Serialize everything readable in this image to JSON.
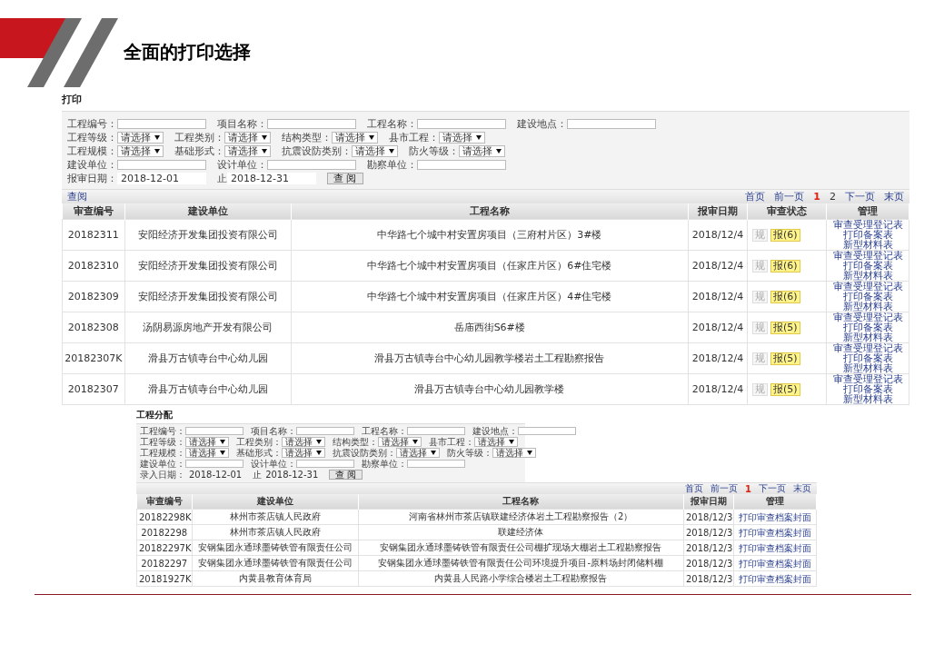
{
  "header": {
    "title": "全面的打印选择"
  },
  "panels": [
    {
      "title": "打印",
      "filters": [
        [
          {
            "kind": "input",
            "label": "工程编号："
          },
          {
            "kind": "input",
            "label": "项目名称："
          },
          {
            "kind": "input",
            "label": "工程名称："
          },
          {
            "kind": "input",
            "label": "建设地点："
          }
        ],
        [
          {
            "kind": "select",
            "label": "工程等级：",
            "value": "请选择"
          },
          {
            "kind": "select",
            "label": "工程类别：",
            "value": "请选择"
          },
          {
            "kind": "select",
            "label": "结构类型：",
            "value": "请选择"
          },
          {
            "kind": "select",
            "label": "县市工程：",
            "value": "请选择"
          }
        ],
        [
          {
            "kind": "select",
            "label": "工程规模：",
            "value": "请选择"
          },
          {
            "kind": "select",
            "label": "基础形式：",
            "value": "请选择"
          },
          {
            "kind": "select",
            "label": "抗震设防类别：",
            "value": "请选择"
          },
          {
            "kind": "select",
            "label": "防火等级：",
            "value": "请选择"
          }
        ],
        [
          {
            "kind": "input",
            "label": "建设单位："
          },
          {
            "kind": "input",
            "label": "设计单位："
          },
          {
            "kind": "input",
            "label": "勘察单位："
          }
        ],
        [
          {
            "kind": "date",
            "label": "报审日期：",
            "value": "2018-12-01"
          },
          {
            "kind": "date",
            "label": "止",
            "value": "2018-12-31"
          },
          {
            "kind": "button",
            "label": "查 阅"
          }
        ]
      ],
      "query_link": "查阅",
      "pager": [
        {
          "kind": "link",
          "label": "首页"
        },
        {
          "kind": "link",
          "label": "前一页"
        },
        {
          "kind": "page",
          "label": "1",
          "selected": true
        },
        {
          "kind": "page",
          "label": "2",
          "selected": false
        },
        {
          "kind": "link",
          "label": "下一页"
        },
        {
          "kind": "link",
          "label": "末页"
        }
      ],
      "columns": [
        {
          "kind": "id",
          "label": "审查编号"
        },
        {
          "kind": "unit",
          "label": "建设单位"
        },
        {
          "kind": "name",
          "label": "工程名称"
        },
        {
          "kind": "date",
          "label": "报审日期"
        },
        {
          "kind": "status",
          "label": "审查状态"
        },
        {
          "kind": "manage",
          "label": "管理"
        }
      ],
      "rows": [
        {
          "cells": [
            {
              "kind": "text",
              "text": "20182311"
            },
            {
              "kind": "text",
              "text": "安阳经济开发集团投资有限公司"
            },
            {
              "kind": "text",
              "text": "中华路七个城中村安置房项目（三府村片区）3#楼"
            },
            {
              "kind": "text",
              "text": "2018/12/4"
            },
            {
              "kind": "status",
              "items": [
                {
                  "label": "规",
                  "highlighted": false
                },
                {
                  "label": "报(6)",
                  "highlighted": true
                }
              ]
            },
            {
              "kind": "links",
              "items": [
                "审查受理登记表",
                "打印备案表",
                "新型材料表"
              ]
            }
          ]
        },
        {
          "cells": [
            {
              "kind": "text",
              "text": "20182310"
            },
            {
              "kind": "text",
              "text": "安阳经济开发集团投资有限公司"
            },
            {
              "kind": "text",
              "text": "中华路七个城中村安置房项目（任家庄片区）6#住宅楼"
            },
            {
              "kind": "text",
              "text": "2018/12/4"
            },
            {
              "kind": "status",
              "items": [
                {
                  "label": "规",
                  "highlighted": false
                },
                {
                  "label": "报(6)",
                  "highlighted": true
                }
              ]
            },
            {
              "kind": "links",
              "items": [
                "审查受理登记表",
                "打印备案表",
                "新型材料表"
              ]
            }
          ]
        },
        {
          "cells": [
            {
              "kind": "text",
              "text": "20182309"
            },
            {
              "kind": "text",
              "text": "安阳经济开发集团投资有限公司"
            },
            {
              "kind": "text",
              "text": "中华路七个城中村安置房项目（任家庄片区）4#住宅楼"
            },
            {
              "kind": "text",
              "text": "2018/12/4"
            },
            {
              "kind": "status",
              "items": [
                {
                  "label": "规",
                  "highlighted": false
                },
                {
                  "label": "报(6)",
                  "highlighted": true
                }
              ]
            },
            {
              "kind": "links",
              "items": [
                "审查受理登记表",
                "打印备案表",
                "新型材料表"
              ]
            }
          ]
        },
        {
          "cells": [
            {
              "kind": "text",
              "text": "20182308"
            },
            {
              "kind": "text",
              "text": "汤阴易源房地产开发有限公司"
            },
            {
              "kind": "text",
              "text": "岳庙西街S6#楼"
            },
            {
              "kind": "text",
              "text": "2018/12/4"
            },
            {
              "kind": "status",
              "items": [
                {
                  "label": "规",
                  "highlighted": false
                },
                {
                  "label": "报(5)",
                  "highlighted": true
                }
              ]
            },
            {
              "kind": "links",
              "items": [
                "审查受理登记表",
                "打印备案表",
                "新型材料表"
              ]
            }
          ]
        },
        {
          "cells": [
            {
              "kind": "text",
              "text": "20182307K"
            },
            {
              "kind": "text",
              "text": "滑县万古镇寺台中心幼儿园"
            },
            {
              "kind": "text",
              "text": "滑县万古镇寺台中心幼儿园教学楼岩土工程勘察报告"
            },
            {
              "kind": "text",
              "text": "2018/12/4"
            },
            {
              "kind": "status",
              "items": [
                {
                  "label": "规",
                  "highlighted": false
                },
                {
                  "label": "报(5)",
                  "highlighted": true
                }
              ]
            },
            {
              "kind": "links",
              "items": [
                "审查受理登记表",
                "打印备案表",
                "新型材料表"
              ]
            }
          ]
        },
        {
          "cells": [
            {
              "kind": "text",
              "text": "20182307"
            },
            {
              "kind": "text",
              "text": "滑县万古镇寺台中心幼儿园"
            },
            {
              "kind": "text",
              "text": "滑县万古镇寺台中心幼儿园教学楼"
            },
            {
              "kind": "text",
              "text": "2018/12/4"
            },
            {
              "kind": "status",
              "items": [
                {
                  "label": "规",
                  "highlighted": false
                },
                {
                  "label": "报(5)",
                  "highlighted": true
                }
              ]
            },
            {
              "kind": "links",
              "items": [
                "审查受理登记表",
                "打印备案表",
                "新型材料表"
              ]
            }
          ]
        }
      ]
    },
    {
      "title": "工程分配",
      "filters": [
        [
          {
            "kind": "input",
            "label": "工程编号："
          },
          {
            "kind": "input",
            "label": "项目名称："
          },
          {
            "kind": "input",
            "label": "工程名称："
          },
          {
            "kind": "input",
            "label": "建设地点："
          }
        ],
        [
          {
            "kind": "select",
            "label": "工程等级：",
            "value": "请选择"
          },
          {
            "kind": "select",
            "label": "工程类别：",
            "value": "请选择"
          },
          {
            "kind": "select",
            "label": "结构类型：",
            "value": "请选择"
          },
          {
            "kind": "select",
            "label": "县市工程：",
            "value": "请选择"
          }
        ],
        [
          {
            "kind": "select",
            "label": "工程规模：",
            "value": "请选择"
          },
          {
            "kind": "select",
            "label": "基础形式：",
            "value": "请选择"
          },
          {
            "kind": "select",
            "label": "抗震设防类别：",
            "value": "请选择"
          },
          {
            "kind": "select",
            "label": "防火等级：",
            "value": "请选择"
          }
        ],
        [
          {
            "kind": "input",
            "label": "建设单位："
          },
          {
            "kind": "input",
            "label": "设计单位："
          },
          {
            "kind": "input",
            "label": "勘察单位："
          }
        ],
        [
          {
            "kind": "date",
            "label": "录入日期：",
            "value": "2018-12-01"
          },
          {
            "kind": "date",
            "label": "止",
            "value": "2018-12-31"
          },
          {
            "kind": "button",
            "label": "查 阅"
          }
        ]
      ],
      "pager": [
        {
          "kind": "link",
          "label": "首页"
        },
        {
          "kind": "link",
          "label": "前一页"
        },
        {
          "kind": "page",
          "label": "1",
          "selected": true
        },
        {
          "kind": "link",
          "label": "下一页"
        },
        {
          "kind": "link",
          "label": "末页"
        }
      ],
      "columns": [
        {
          "kind": "id",
          "label": "审查编号"
        },
        {
          "kind": "unit",
          "label": "建设单位"
        },
        {
          "kind": "name",
          "label": "工程名称"
        },
        {
          "kind": "date",
          "label": "报审日期"
        },
        {
          "kind": "manage",
          "label": "管理"
        }
      ],
      "rows": [
        {
          "cells": [
            {
              "kind": "text",
              "text": "20182298K"
            },
            {
              "kind": "text",
              "text": "林州市茶店镇人民政府"
            },
            {
              "kind": "text",
              "text": "河南省林州市茶店镇联建经济体岩土工程勘察报告（2）"
            },
            {
              "kind": "text",
              "text": "2018/12/3"
            },
            {
              "kind": "links",
              "items": [
                "打印审查档案封面"
              ]
            }
          ]
        },
        {
          "cells": [
            {
              "kind": "text",
              "text": "20182298"
            },
            {
              "kind": "text",
              "text": "林州市茶店镇人民政府"
            },
            {
              "kind": "text",
              "text": "联建经济体"
            },
            {
              "kind": "text",
              "text": "2018/12/3"
            },
            {
              "kind": "links",
              "items": [
                "打印审查档案封面"
              ]
            }
          ]
        },
        {
          "cells": [
            {
              "kind": "text",
              "text": "20182297K"
            },
            {
              "kind": "text",
              "text": "安钢集团永通球墨铸铁管有限责任公司"
            },
            {
              "kind": "text",
              "text": "安钢集团永通球墨铸铁管有限责任公司棚扩现场大棚岩土工程勘察报告"
            },
            {
              "kind": "text",
              "text": "2018/12/3"
            },
            {
              "kind": "links",
              "items": [
                "打印审查档案封面"
              ]
            }
          ]
        },
        {
          "cells": [
            {
              "kind": "text",
              "text": "20182297"
            },
            {
              "kind": "text",
              "text": "安钢集团永通球墨铸铁管有限责任公司"
            },
            {
              "kind": "text",
              "text": "安钢集团永通球墨铸铁管有限责任公司环境提升项目-原料场封闭储料棚"
            },
            {
              "kind": "text",
              "text": "2018/12/3"
            },
            {
              "kind": "links",
              "items": [
                "打印审查档案封面"
              ]
            }
          ]
        },
        {
          "cells": [
            {
              "kind": "text",
              "text": "20181927K"
            },
            {
              "kind": "text",
              "text": "内黄县教育体育局"
            },
            {
              "kind": "text",
              "text": "内黄县人民路小学综合楼岩土工程勘察报告"
            },
            {
              "kind": "text",
              "text": "2018/12/3"
            },
            {
              "kind": "links",
              "items": [
                "打印审查档案封面"
              ]
            }
          ]
        }
      ]
    }
  ]
}
